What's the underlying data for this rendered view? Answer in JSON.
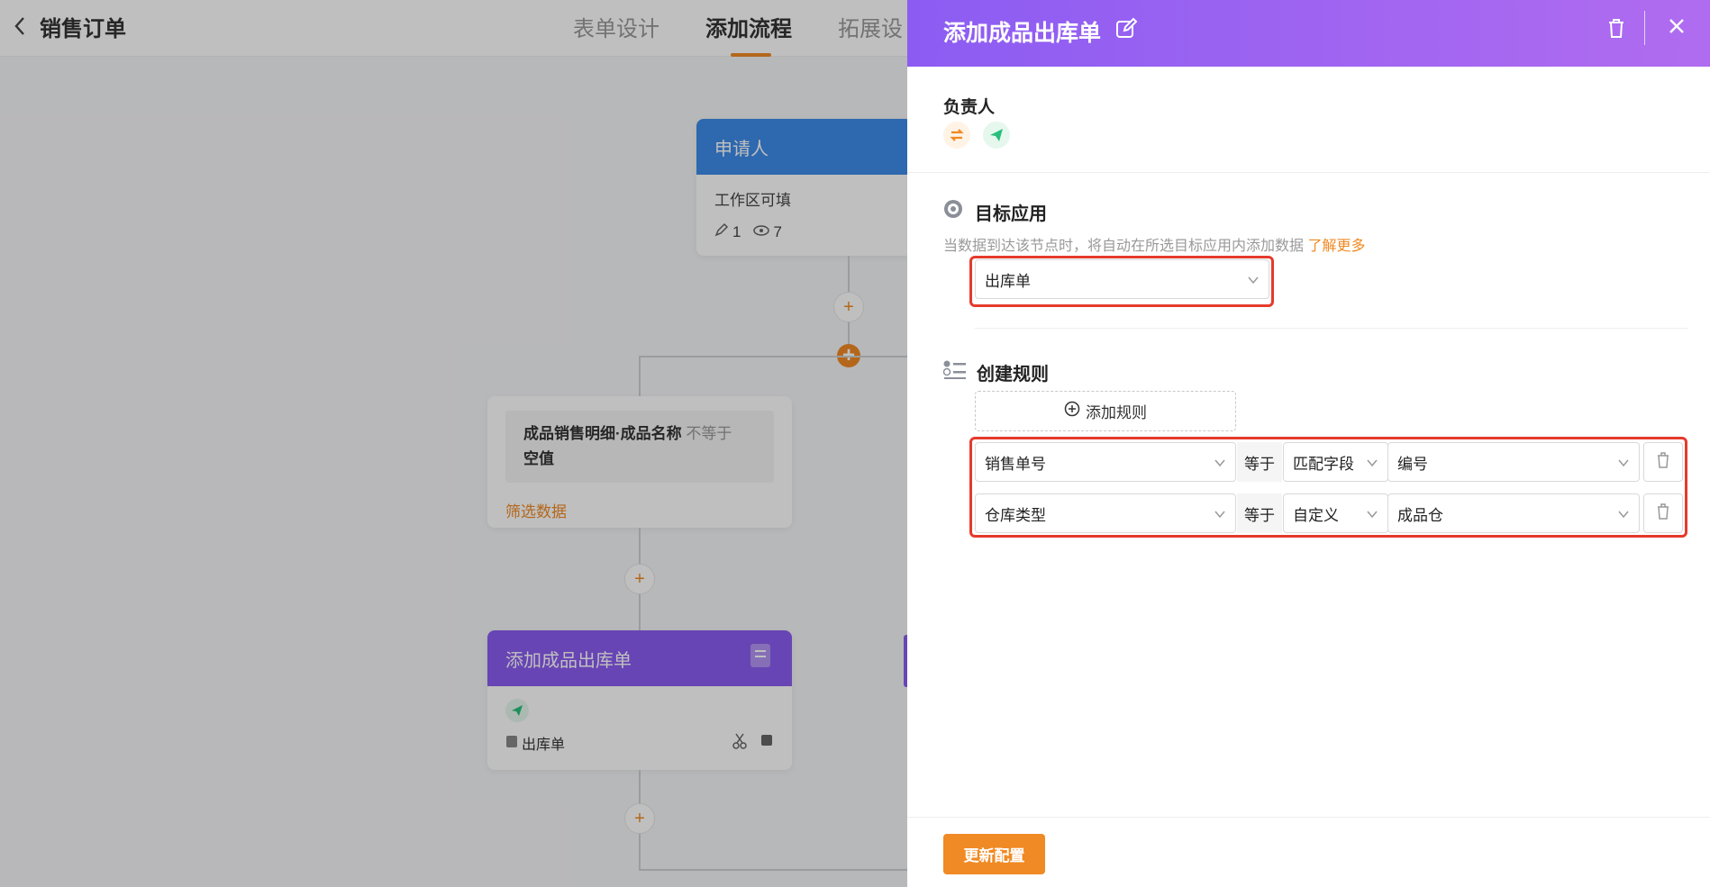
{
  "header": {
    "title": "销售订单",
    "tabs": [
      {
        "label": "表单设计"
      },
      {
        "label": "添加流程"
      },
      {
        "label": "拓展设"
      }
    ]
  },
  "flow": {
    "applicant_card": {
      "title": "申请人",
      "desc": "工作区可填",
      "edit_count": "1",
      "view_count": "7"
    },
    "filter_card": {
      "field": "成品销售明细·成品名称",
      "operator": "不等于",
      "value": "空值",
      "footer": "筛选数据"
    },
    "add_card": {
      "title": "添加成品出库单",
      "target": "出库单"
    },
    "plus": "+"
  },
  "drawer": {
    "title": "添加成品出库单",
    "owner_label": "负责人",
    "target_section": {
      "title": "目标应用",
      "hint": "当数据到达该节点时，将自动在所选目标应用内添加数据",
      "hint_link": "了解更多",
      "selected": "出库单"
    },
    "rules_section": {
      "title": "创建规则",
      "add_button": "添加规则",
      "rules": [
        {
          "field": "销售单号",
          "op": "等于",
          "mode": "匹配字段",
          "value": "编号"
        },
        {
          "field": "仓库类型",
          "op": "等于",
          "mode": "自定义",
          "value": "成品仓"
        }
      ]
    },
    "update_button": "更新配置"
  },
  "colors": {
    "accent": "#f08a24",
    "drawer_header_start": "#8c5cf2",
    "drawer_header_end": "#b06cf0",
    "applicant_header": "#3e8be8",
    "add_card_header": "#8b5cf0",
    "highlight": "#e53a2c",
    "send_icon": "#27c07a"
  },
  "icons": [
    "back-icon",
    "edit-icon",
    "trash-icon",
    "close-icon",
    "swap-icon",
    "send-icon",
    "target-icon",
    "rules-icon",
    "plus-circle-icon",
    "chevron-down-icon",
    "scissors-icon",
    "copy-icon",
    "doc-icon",
    "pencil-icon",
    "eye-icon"
  ]
}
